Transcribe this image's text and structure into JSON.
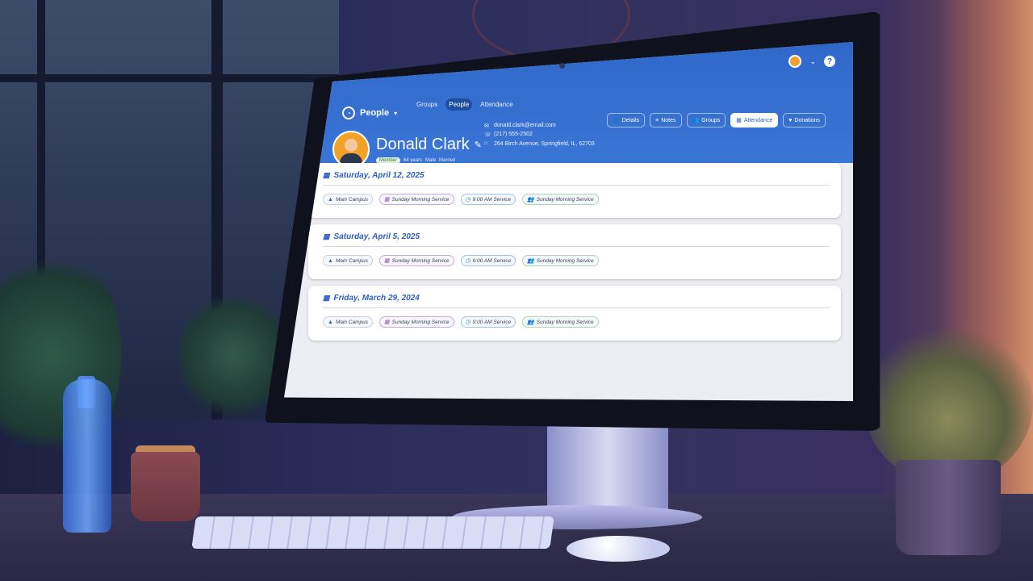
{
  "app": {
    "brand": "People",
    "nav_tabs": [
      "Groups",
      "People",
      "Attendance"
    ],
    "active_nav": "People"
  },
  "person": {
    "name": "Donald Clark",
    "badge": "Member",
    "age": "64 years",
    "gender": "Male",
    "marital_status": "Married",
    "email": "donald.clark@email.com",
    "phone": "(217) 555-2502",
    "address": "264 Birch Avenue, Springfield, IL, 62703"
  },
  "actions": [
    {
      "label": "Details",
      "icon": "person-icon",
      "active": false
    },
    {
      "label": "Notes",
      "icon": "notes-icon",
      "active": false
    },
    {
      "label": "Groups",
      "icon": "group-icon",
      "active": false
    },
    {
      "label": "Attendance",
      "icon": "calendar-icon",
      "active": true
    },
    {
      "label": "Donations",
      "icon": "donation-icon",
      "active": false
    }
  ],
  "attendance": [
    {
      "date": "Saturday, April 12, 2025",
      "campus": "Main Campus",
      "event": "Sunday Morning Service",
      "time": "9:00 AM Service",
      "group": "Sunday Morning Service"
    },
    {
      "date": "Saturday, April 5, 2025",
      "campus": "Main Campus",
      "event": "Sunday Morning Service",
      "time": "9:00 AM Service",
      "group": "Sunday Morning Service"
    },
    {
      "date": "Friday, March 29, 2024",
      "campus": "Main Campus",
      "event": "Sunday Morning Service",
      "time": "9:00 AM Service",
      "group": "Sunday Morning Service"
    }
  ],
  "colors": {
    "header_blue": "#2f68c9",
    "accent_orange": "#f2a227",
    "group_green": "#2f9a48",
    "event_purple": "#9a52d0"
  }
}
